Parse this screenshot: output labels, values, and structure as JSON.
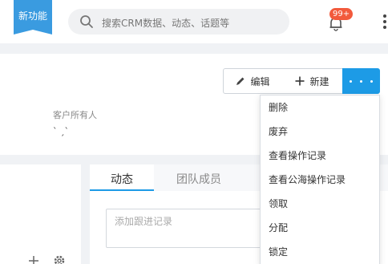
{
  "topbar": {
    "new_feature": "新功能",
    "search_placeholder": "搜索CRM数据、动态、话题等",
    "notification_badge": "99+"
  },
  "toolbar": {
    "edit_label": "编辑",
    "new_label": "新建"
  },
  "customer": {
    "owner_label": "客户所有人",
    "owner_value": "ˋ  ˏ`"
  },
  "tabs": [
    {
      "label": "动态"
    },
    {
      "label": "团队成员"
    }
  ],
  "followup": {
    "placeholder": "添加跟进记录"
  },
  "more_menu": {
    "items": [
      {
        "label": "删除"
      },
      {
        "label": "废弃"
      },
      {
        "label": "查看操作记录"
      },
      {
        "label": "查看公海操作记录"
      },
      {
        "label": "领取"
      },
      {
        "label": "分配"
      },
      {
        "label": "锁定"
      }
    ]
  },
  "colors": {
    "accent": "#1d9be6",
    "badge": "#f25a3c",
    "new_feature": "#3a9be0",
    "background_gray": "#f0f2f5"
  }
}
